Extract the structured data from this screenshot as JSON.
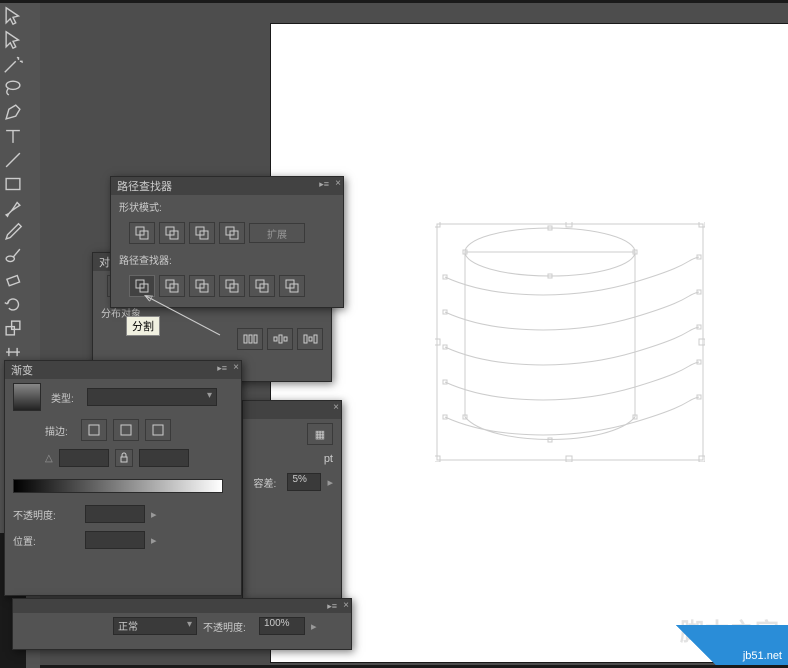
{
  "pathfinder": {
    "title": "路径查找器",
    "shape_modes_label": "形状模式:",
    "pathfinders_label": "路径查找器:",
    "expand_label": "扩展",
    "shape_modes": [
      "unite",
      "minus-front",
      "intersect",
      "exclude"
    ],
    "pf_ops": [
      "divide",
      "trim",
      "merge",
      "crop",
      "outline",
      "minus-back"
    ],
    "tooltip_divide": "分割"
  },
  "align": {
    "tab_prefix": "对",
    "distribute_label": "分布对象"
  },
  "gradient": {
    "title": "渐变",
    "type_label": "类型:",
    "type_value": "",
    "stroke_label": "描边:",
    "opacity_label": "不透明度:",
    "opacity_value": "",
    "position_label": "位置:",
    "position_value": ""
  },
  "transparency": {
    "blend_label": "正常",
    "opacity_label": "不透明度:",
    "opacity_value": "100%",
    "tolerance_label": "容差:",
    "tolerance_value": "5%"
  },
  "hidden_panel": {
    "suffix": "pt"
  },
  "watermark": {
    "text": "脚本之家",
    "url": "jb51.net"
  },
  "annotation": {
    "arrow_color": "#e01010"
  }
}
